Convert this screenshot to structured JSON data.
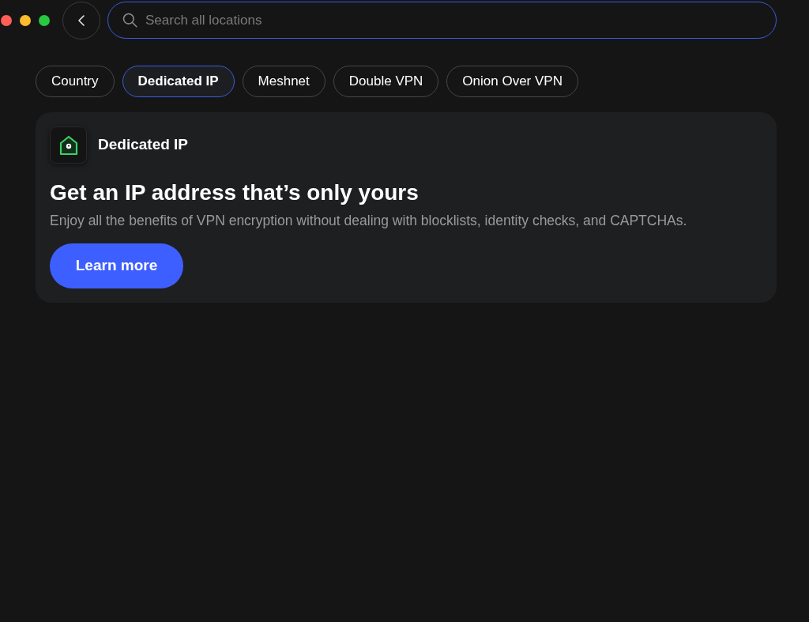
{
  "window_controls": [
    {
      "color": "#ff5f57"
    },
    {
      "color": "#febc2e"
    },
    {
      "color": "#28c840"
    }
  ],
  "search": {
    "placeholder": "Search all locations",
    "focused": true
  },
  "tabs": [
    {
      "label": "Country",
      "selected": false
    },
    {
      "label": "Dedicated IP",
      "selected": true
    },
    {
      "label": "Meshnet",
      "selected": false
    },
    {
      "label": "Double VPN",
      "selected": false
    },
    {
      "label": "Onion Over VPN",
      "selected": false
    }
  ],
  "promo_card": {
    "title": "Dedicated IP",
    "headline": "Get an IP address that’s only yours",
    "description": "Enjoy all the benefits of VPN encryption without dealing with blocklists, identity checks, and CAPTCHAs.",
    "button": "Learn more"
  }
}
